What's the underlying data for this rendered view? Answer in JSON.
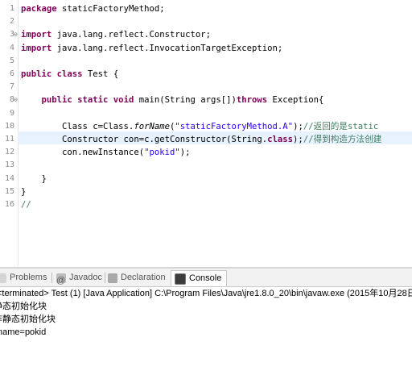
{
  "editor": {
    "lines": [
      {
        "n": "1",
        "fold": "",
        "html": "<span class='kw'>package</span> staticFactoryMethod;"
      },
      {
        "n": "2",
        "fold": "",
        "html": ""
      },
      {
        "n": "3",
        "fold": "⊖",
        "html": "<span class='kw'>import</span> java.lang.reflect.Constructor;"
      },
      {
        "n": "4",
        "fold": "",
        "html": "<span class='kw'>import</span> java.lang.reflect.InvocationTargetException;"
      },
      {
        "n": "5",
        "fold": "",
        "html": ""
      },
      {
        "n": "6",
        "fold": "",
        "html": "<span class='kw'>public class</span> Test {"
      },
      {
        "n": "7",
        "fold": "",
        "html": ""
      },
      {
        "n": "8",
        "fold": "⊖",
        "html": "    <span class='kw'>public static void</span> main(String args[])<span class='kw'>throws</span> Exception{"
      },
      {
        "n": "9",
        "fold": "",
        "html": ""
      },
      {
        "n": "10",
        "fold": "",
        "html": "        Class c=Class.<i>forName</i>(<span class='str'>\"staticFactoryMethod.A\"</span>);<span class='cm'>//返回的是static</span>"
      },
      {
        "n": "11",
        "fold": "",
        "html": "        Constructor con=c.getConstructor(String.<span class='kw'>class</span>);<span class='cm'>//得到构造方法创建</span>"
      },
      {
        "n": "12",
        "fold": "",
        "html": "        con.newInstance(<span class='str'>\"pokid\"</span>);"
      },
      {
        "n": "13",
        "fold": "",
        "html": ""
      },
      {
        "n": "14",
        "fold": "",
        "html": "    }"
      },
      {
        "n": "15",
        "fold": "",
        "html": "}"
      },
      {
        "n": "16",
        "fold": "",
        "html": "<span class='cm'>//</span>"
      }
    ]
  },
  "tabs": {
    "problems": "Problems",
    "javadoc": "Javadoc",
    "declaration": "Declaration",
    "console": "Console"
  },
  "console": {
    "status": "<terminated> Test (1) [Java Application] C:\\Program Files\\Java\\jre1.8.0_20\\bin\\javaw.exe (2015年10月28日",
    "output": [
      "静态初始化块",
      "非静态初始化块",
      "name=pokid"
    ]
  },
  "colors": {
    "keyword": "#7f0055",
    "string": "#2a00ff",
    "comment": "#3f7f5f",
    "current_line": "#e8f2fe"
  }
}
